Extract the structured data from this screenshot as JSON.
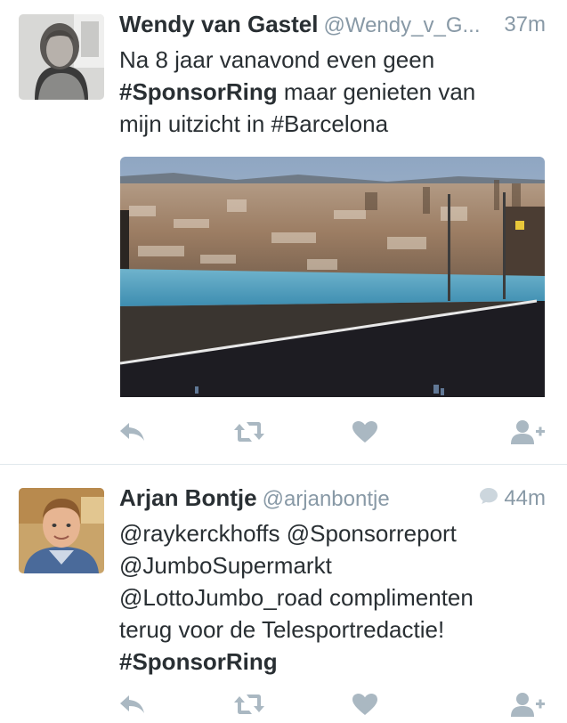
{
  "tweets": [
    {
      "name": "Wendy van Gastel",
      "handle": "@Wendy_v_G...",
      "time": "37m",
      "lines": [
        [
          {
            "t": "Na 8 jaar vanavond even geen",
            "tag": false
          }
        ],
        [
          {
            "t": "#SponsorRing",
            "tag": true
          },
          {
            "t": " maar genieten van",
            "tag": false
          }
        ],
        [
          {
            "t": "mijn uitzicht in #Barcelona",
            "tag": false
          }
        ]
      ],
      "has_media": true
    },
    {
      "name": "Arjan Bontje",
      "handle": "@arjanbontje",
      "time": "44m",
      "lines": [
        [
          {
            "t": "@raykerckhoffs @Sponsorreport",
            "tag": false
          }
        ],
        [
          {
            "t": "@JumboSupermarkt",
            "tag": false
          }
        ],
        [
          {
            "t": "@LottoJumbo_road complimenten",
            "tag": false
          }
        ],
        [
          {
            "t": "terug voor de Telesportredactie!",
            "tag": false
          }
        ],
        [
          {
            "t": "#SponsorRing",
            "tag": true
          }
        ]
      ],
      "has_media": false
    }
  ],
  "icons": {
    "reply": "reply-icon",
    "retweet": "retweet-icon",
    "like": "heart-icon",
    "follow": "follow-icon",
    "conversation": "speech-bubble-icon"
  },
  "colors": {
    "text": "#292f33",
    "muted": "#8899a6",
    "action_icon": "#aab8c2",
    "divider": "#e1e8ed"
  }
}
